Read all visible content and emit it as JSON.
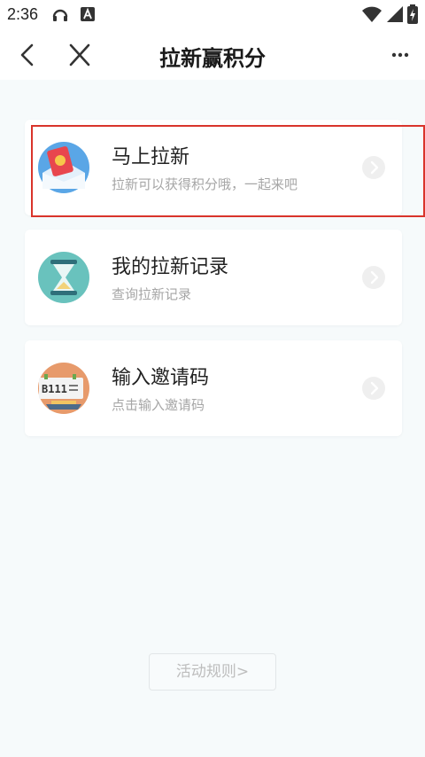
{
  "status_bar": {
    "time": "2:36",
    "icons": [
      "headset-icon",
      "a-notification-icon",
      "wifi-icon",
      "signal-icon",
      "battery-charging-icon"
    ]
  },
  "header": {
    "title": "拉新赢积分",
    "back_icon": "chevron-left-icon",
    "close_icon": "close-icon",
    "more_icon": "more-icon"
  },
  "cards": [
    {
      "title": "马上拉新",
      "desc": "拉新可以获得积分哦，一起来吧",
      "icon": "red-envelope-icon"
    },
    {
      "title": "我的拉新记录",
      "desc": "查询拉新记录",
      "icon": "hourglass-icon"
    },
    {
      "title": "输入邀请码",
      "desc": "点击输入邀请码",
      "icon": "invite-code-icon",
      "code_text": "B111"
    }
  ],
  "footer": {
    "rules_label": "活动规则>"
  },
  "colors": {
    "highlight": "#d9342b",
    "background": "#f6fafb"
  }
}
